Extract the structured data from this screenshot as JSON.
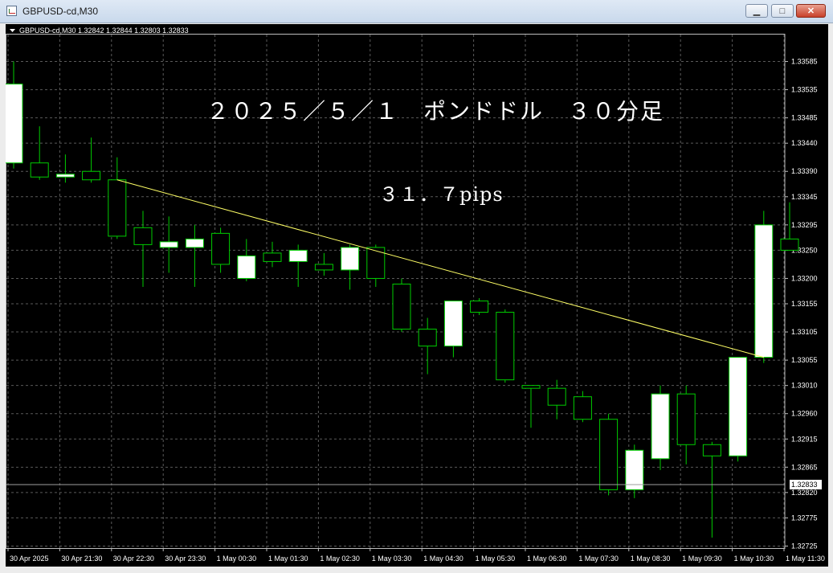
{
  "window": {
    "title": "GBPUSD-cd,M30",
    "minimize_label": "▁",
    "maximize_label": "□",
    "close_label": "✕"
  },
  "colors": {
    "background": "#000000",
    "grid": "#5a5a5a",
    "candle_up_body": "#ffffff",
    "candle_down_body": "#000000",
    "candle_outline": "#00cc00",
    "trendline": "#ffff66",
    "text": "#ffffff",
    "titlebar": "#c9d9ec"
  },
  "chart_data": {
    "type": "candlestick",
    "symbol_info": "GBPUSD-cd,M30  1.32842 1.32844 1.32803 1.32833",
    "annotations": [
      "２０２５／５／１　ポンドドル　３０分足",
      "３１．７pips"
    ],
    "current_price_label": "1.32833",
    "ylim": [
      1.327,
      1.3361
    ],
    "y_ticks": [
      "1.33585",
      "1.33535",
      "1.33485",
      "1.33440",
      "1.33390",
      "1.33345",
      "1.33295",
      "1.33250",
      "1.33200",
      "1.33155",
      "1.33105",
      "1.33055",
      "1.33010",
      "1.32960",
      "1.32915",
      "1.32865",
      "1.32820",
      "1.32775",
      "1.32725"
    ],
    "x_ticks": [
      "30 Apr 2025",
      "30 Apr 21:30",
      "30 Apr 22:30",
      "30 Apr 23:30",
      "1 May 00:30",
      "1 May 01:30",
      "1 May 02:30",
      "1 May 03:30",
      "1 May 04:30",
      "1 May 05:30",
      "1 May 06:30",
      "1 May 07:30",
      "1 May 08:30",
      "1 May 09:30",
      "1 May 10:30",
      "1 May 11:30"
    ],
    "candles": [
      {
        "o": 1.33405,
        "h": 1.33585,
        "l": 1.33395,
        "c": 1.33545
      },
      {
        "o": 1.33405,
        "h": 1.3347,
        "l": 1.33375,
        "c": 1.3338
      },
      {
        "o": 1.3338,
        "h": 1.3342,
        "l": 1.3337,
        "c": 1.33385
      },
      {
        "o": 1.3339,
        "h": 1.3345,
        "l": 1.3337,
        "c": 1.33375
      },
      {
        "o": 1.33375,
        "h": 1.33415,
        "l": 1.3327,
        "c": 1.33275
      },
      {
        "o": 1.3329,
        "h": 1.3332,
        "l": 1.33185,
        "c": 1.3326
      },
      {
        "o": 1.33255,
        "h": 1.3331,
        "l": 1.3321,
        "c": 1.33265
      },
      {
        "o": 1.33255,
        "h": 1.33295,
        "l": 1.33185,
        "c": 1.3327
      },
      {
        "o": 1.3328,
        "h": 1.3329,
        "l": 1.3321,
        "c": 1.33225
      },
      {
        "o": 1.332,
        "h": 1.3327,
        "l": 1.33195,
        "c": 1.3324
      },
      {
        "o": 1.33245,
        "h": 1.33265,
        "l": 1.3322,
        "c": 1.3323
      },
      {
        "o": 1.3323,
        "h": 1.3326,
        "l": 1.33185,
        "c": 1.3325
      },
      {
        "o": 1.33225,
        "h": 1.33245,
        "l": 1.33205,
        "c": 1.33215
      },
      {
        "o": 1.33215,
        "h": 1.3326,
        "l": 1.3318,
        "c": 1.33255
      },
      {
        "o": 1.33255,
        "h": 1.3326,
        "l": 1.33185,
        "c": 1.332
      },
      {
        "o": 1.3319,
        "h": 1.332,
        "l": 1.33105,
        "c": 1.3311
      },
      {
        "o": 1.3311,
        "h": 1.3313,
        "l": 1.3303,
        "c": 1.3308
      },
      {
        "o": 1.3308,
        "h": 1.3316,
        "l": 1.3306,
        "c": 1.3316
      },
      {
        "o": 1.3316,
        "h": 1.33165,
        "l": 1.33135,
        "c": 1.3314
      },
      {
        "o": 1.3314,
        "h": 1.33145,
        "l": 1.33015,
        "c": 1.3302
      },
      {
        "o": 1.3301,
        "h": 1.3301,
        "l": 1.32935,
        "c": 1.33005
      },
      {
        "o": 1.33005,
        "h": 1.3302,
        "l": 1.3295,
        "c": 1.32975
      },
      {
        "o": 1.3299,
        "h": 1.33,
        "l": 1.32945,
        "c": 1.3295
      },
      {
        "o": 1.3295,
        "h": 1.3296,
        "l": 1.32815,
        "c": 1.32825
      },
      {
        "o": 1.32825,
        "h": 1.32905,
        "l": 1.3281,
        "c": 1.32895
      },
      {
        "o": 1.3288,
        "h": 1.3301,
        "l": 1.3286,
        "c": 1.32995
      },
      {
        "o": 1.32995,
        "h": 1.3301,
        "l": 1.3287,
        "c": 1.32905
      },
      {
        "o": 1.32905,
        "h": 1.3291,
        "l": 1.3274,
        "c": 1.32885
      },
      {
        "o": 1.32885,
        "h": 1.3306,
        "l": 1.32875,
        "c": 1.3306
      },
      {
        "o": 1.3306,
        "h": 1.3332,
        "l": 1.3305,
        "c": 1.33295
      },
      {
        "o": 1.3327,
        "h": 1.33335,
        "l": 1.3325,
        "c": 1.3325
      }
    ],
    "trendline": {
      "from_index": 4,
      "from_price": 1.33375,
      "to_index": 29,
      "to_price": 1.3306
    }
  }
}
